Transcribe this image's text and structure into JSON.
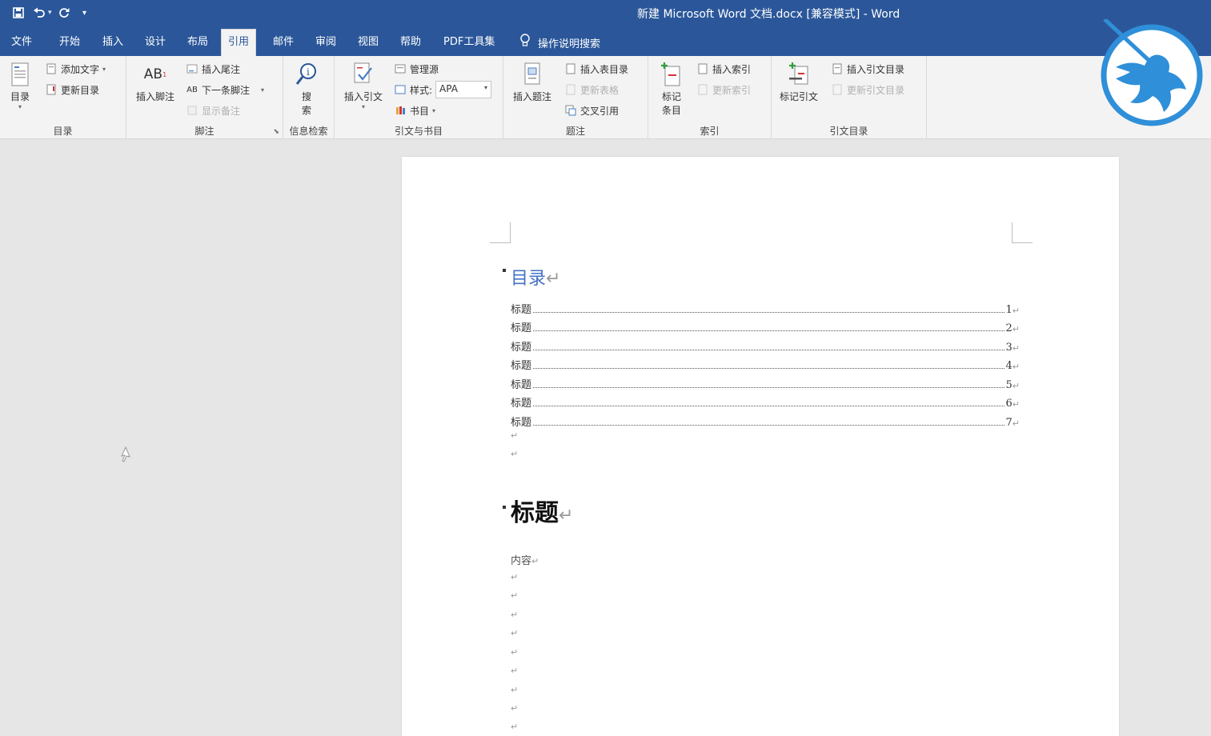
{
  "window": {
    "title": "新建 Microsoft Word 文档.docx [兼容模式]  -  Word"
  },
  "qat": {
    "icons": [
      "save-icon",
      "undo-icon",
      "redo-icon",
      "customize-icon"
    ]
  },
  "tabs": [
    {
      "label": "文件"
    },
    {
      "label": "开始"
    },
    {
      "label": "插入"
    },
    {
      "label": "设计"
    },
    {
      "label": "布局"
    },
    {
      "label": "引用",
      "active": true
    },
    {
      "label": "邮件"
    },
    {
      "label": "审阅"
    },
    {
      "label": "视图"
    },
    {
      "label": "帮助"
    },
    {
      "label": "PDF工具集"
    }
  ],
  "tell_me": {
    "label": "操作说明搜索"
  },
  "ribbon": {
    "toc": {
      "group_label": "目录",
      "toc_button": "目录",
      "add_text": "添加文字",
      "update_toc": "更新目录"
    },
    "footnotes": {
      "group_label": "脚注",
      "insert_footnote": "插入脚注",
      "ab_glyph": "AB",
      "insert_endnote": "插入尾注",
      "next_footnote": "下一条脚注",
      "show_notes": "显示备注"
    },
    "research": {
      "group_label": "信息检索",
      "search_line1": "搜",
      "search_line2": "索"
    },
    "citations": {
      "group_label": "引文与书目",
      "insert_citation": "插入引文",
      "manage_sources": "管理源",
      "style_label": "样式:",
      "style_value": "APA",
      "bibliography": "书目"
    },
    "captions": {
      "group_label": "题注",
      "insert_caption": "插入题注",
      "insert_table_of_figures": "插入表目录",
      "update_table": "更新表格",
      "cross_reference": "交叉引用"
    },
    "index": {
      "group_label": "索引",
      "mark_entry_line1": "标记",
      "mark_entry_line2": "条目",
      "insert_index": "插入索引",
      "update_index": "更新索引"
    },
    "authorities": {
      "group_label": "引文目录",
      "mark_citation": "标记引文",
      "insert_toa": "插入引文目录",
      "update_toa": "更新引文目录"
    }
  },
  "document": {
    "toc_heading": "目录",
    "toc_entries": [
      {
        "text": "标题",
        "page": "1"
      },
      {
        "text": "标题",
        "page": "2"
      },
      {
        "text": "标题",
        "page": "3"
      },
      {
        "text": "标题",
        "page": "4"
      },
      {
        "text": "标题",
        "page": "5"
      },
      {
        "text": "标题",
        "page": "6"
      },
      {
        "text": "标题",
        "page": "7"
      }
    ],
    "heading1": "标题",
    "body_text": "内容",
    "para_mark": "↵"
  },
  "colors": {
    "title_bar": "#2b579a",
    "ribbon_bg": "#f3f3f3",
    "toc_heading": "#4472c4",
    "logo": "#2f8fd8"
  }
}
